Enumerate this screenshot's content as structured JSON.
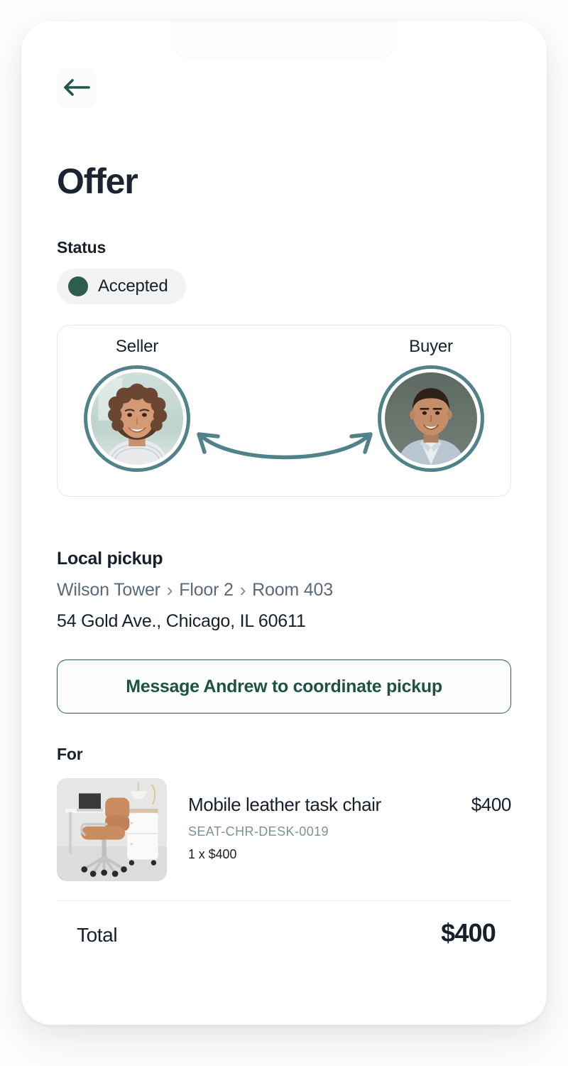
{
  "screen": {
    "back_icon": "arrow-left-icon",
    "title": "Offer"
  },
  "status": {
    "label": "Status",
    "value": "Accepted",
    "dot_color": "#2d5d4f",
    "pill_color": "#f2f3f2"
  },
  "parties": {
    "seller_label": "Seller",
    "buyer_label": "Buyer",
    "ring_color": "#4f8289",
    "arrow_icon": "double-headed-arrow-icon"
  },
  "pickup": {
    "title": "Local pickup",
    "breadcrumb": [
      "Wilson Tower",
      "Floor 2",
      "Room 403"
    ],
    "separator": "›",
    "address": "54 Gold Ave., Chicago, IL 60611",
    "breadcrumb_color": "#5a6a7a"
  },
  "message_button": {
    "label": "Message Andrew to coordinate pickup",
    "border_color": "#2d5d4f",
    "text_color": "#1d5344"
  },
  "order": {
    "for_label": "For",
    "items": [
      {
        "name": "Mobile leather task chair",
        "price": "$400",
        "sku": "SEAT-CHR-DESK-0019",
        "quantity_line": "1 x $400",
        "thumb_icon": "office-chair-photo"
      }
    ],
    "total_label": "Total",
    "total_value": "$400"
  }
}
